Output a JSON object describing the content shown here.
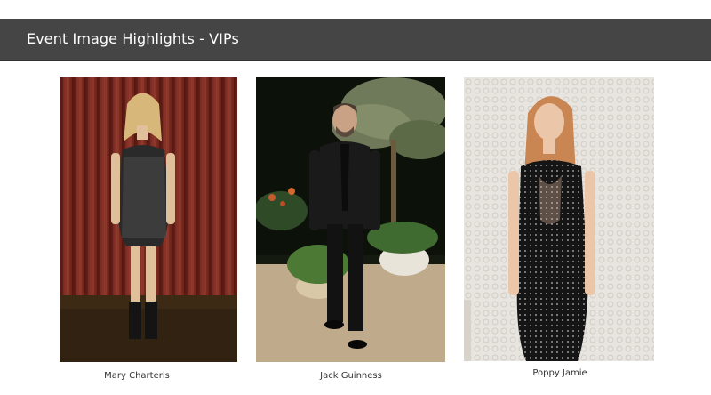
{
  "slide": {
    "title": "Event Image Highlights - VIPs"
  },
  "vips": [
    {
      "name": "Mary Charteris"
    },
    {
      "name": "Jack Guinness"
    },
    {
      "name": "Poppy Jamie"
    }
  ],
  "colors": {
    "header_bg": "#454545",
    "header_text": "#ffffff",
    "caption_text": "#333333"
  }
}
